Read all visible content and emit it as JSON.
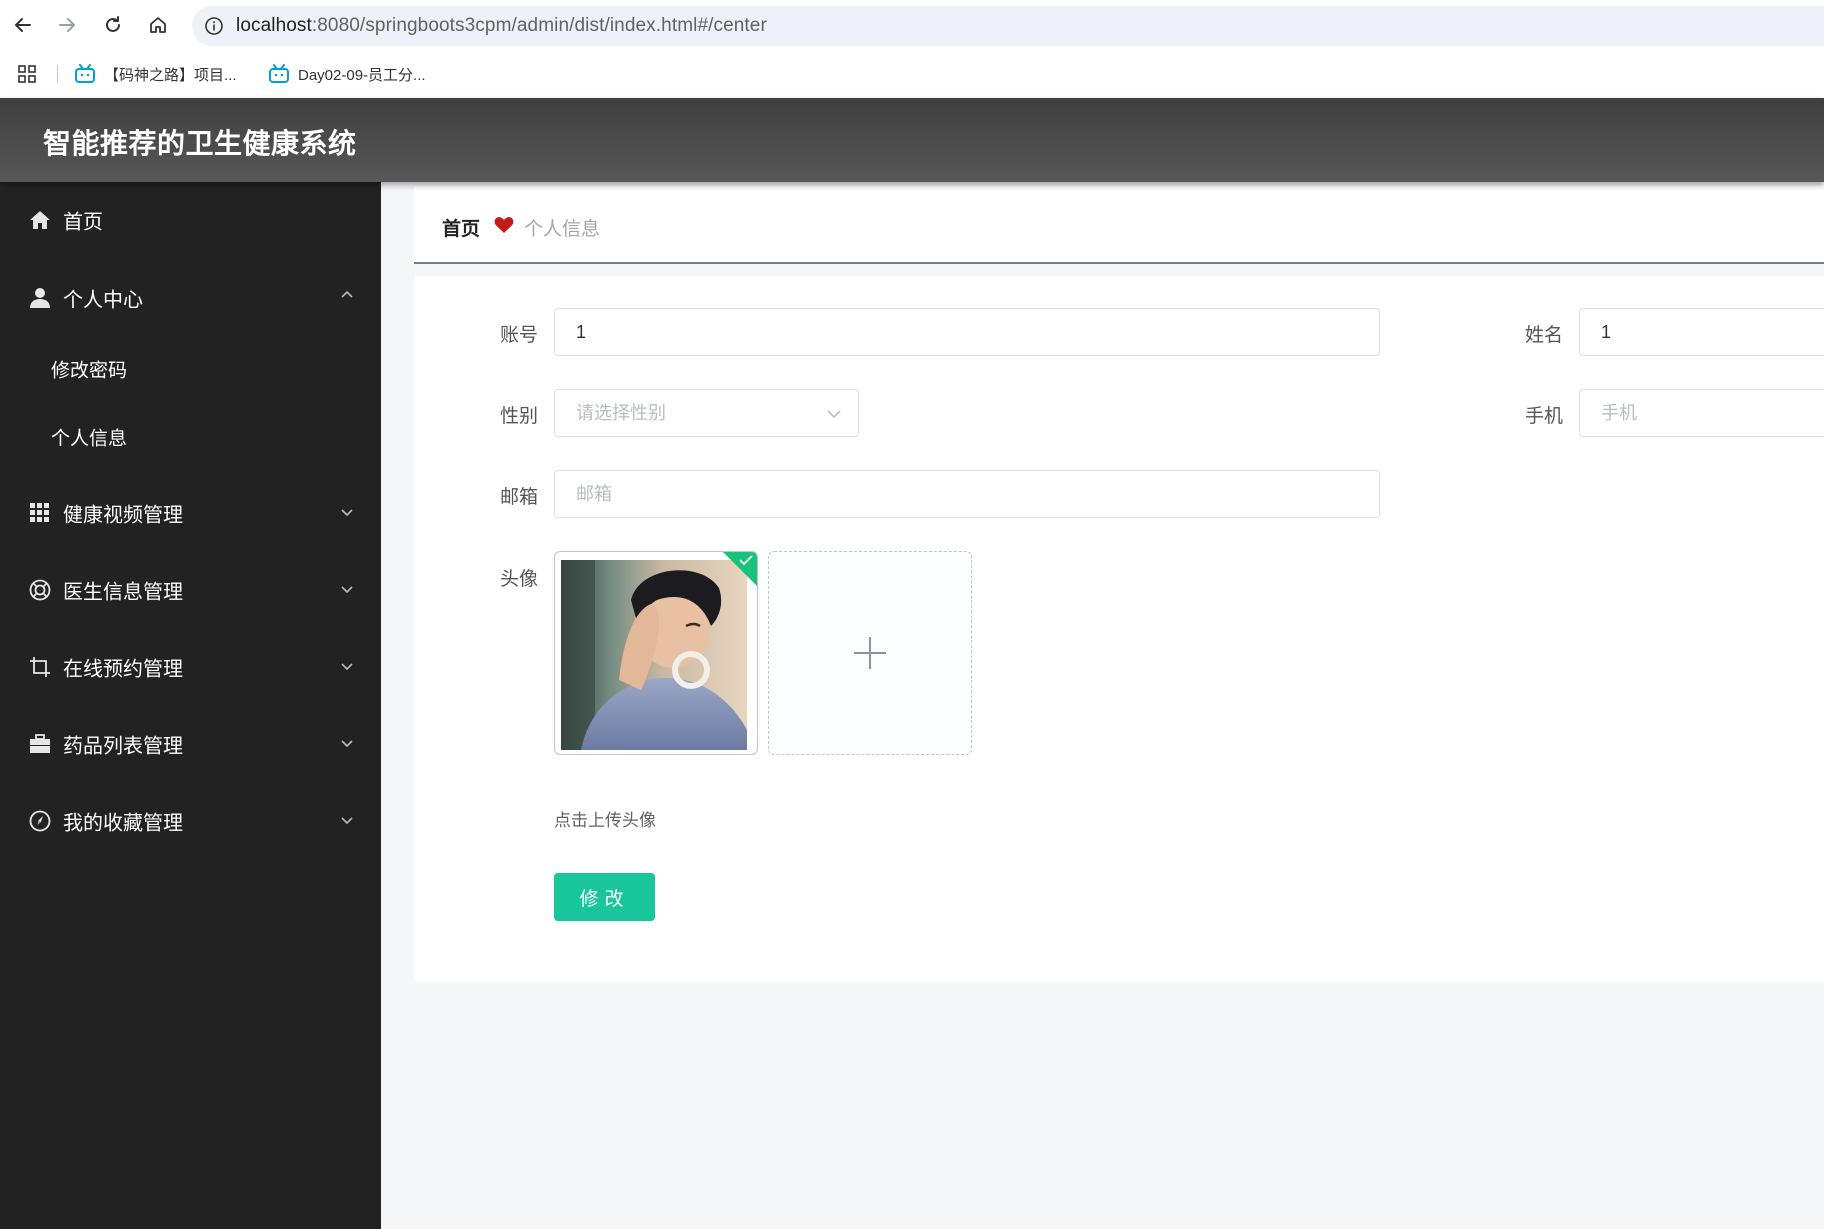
{
  "browser": {
    "url_host": "localhost",
    "url_rest": ":8080/springboots3cpm/admin/dist/index.html#/center",
    "bookmarks": [
      {
        "label": "【码神之路】项目..."
      },
      {
        "label": "Day02-09-员工分..."
      }
    ]
  },
  "app": {
    "title": "智能推荐的卫生健康系统"
  },
  "sidebar": {
    "items": [
      {
        "label": "首页",
        "icon": "home-icon"
      },
      {
        "label": "个人中心",
        "icon": "user-icon",
        "expanded": true,
        "children": [
          {
            "label": "修改密码"
          },
          {
            "label": "个人信息"
          }
        ]
      },
      {
        "label": "健康视频管理",
        "icon": "grid-icon"
      },
      {
        "label": "医生信息管理",
        "icon": "lifebuoy-icon"
      },
      {
        "label": "在线预约管理",
        "icon": "crop-icon"
      },
      {
        "label": "药品列表管理",
        "icon": "briefcase-icon"
      },
      {
        "label": "我的收藏管理",
        "icon": "compass-icon"
      }
    ]
  },
  "breadcrumb": {
    "home": "首页",
    "current": "个人信息",
    "separator_icon": "heart-icon"
  },
  "form": {
    "account": {
      "label": "账号",
      "value": "1"
    },
    "name": {
      "label": "姓名",
      "value": "1"
    },
    "gender": {
      "label": "性别",
      "placeholder": "请选择性别"
    },
    "phone": {
      "label": "手机",
      "placeholder": "手机"
    },
    "email": {
      "label": "邮箱",
      "placeholder": "邮箱"
    },
    "avatar": {
      "label": "头像",
      "tip": "点击上传头像"
    },
    "submit_label": "修改"
  },
  "colors": {
    "accent": "#19c59b",
    "sidebar_bg": "#232222",
    "header_bg": "#4a4a4a",
    "heart": "#c41c1c"
  }
}
